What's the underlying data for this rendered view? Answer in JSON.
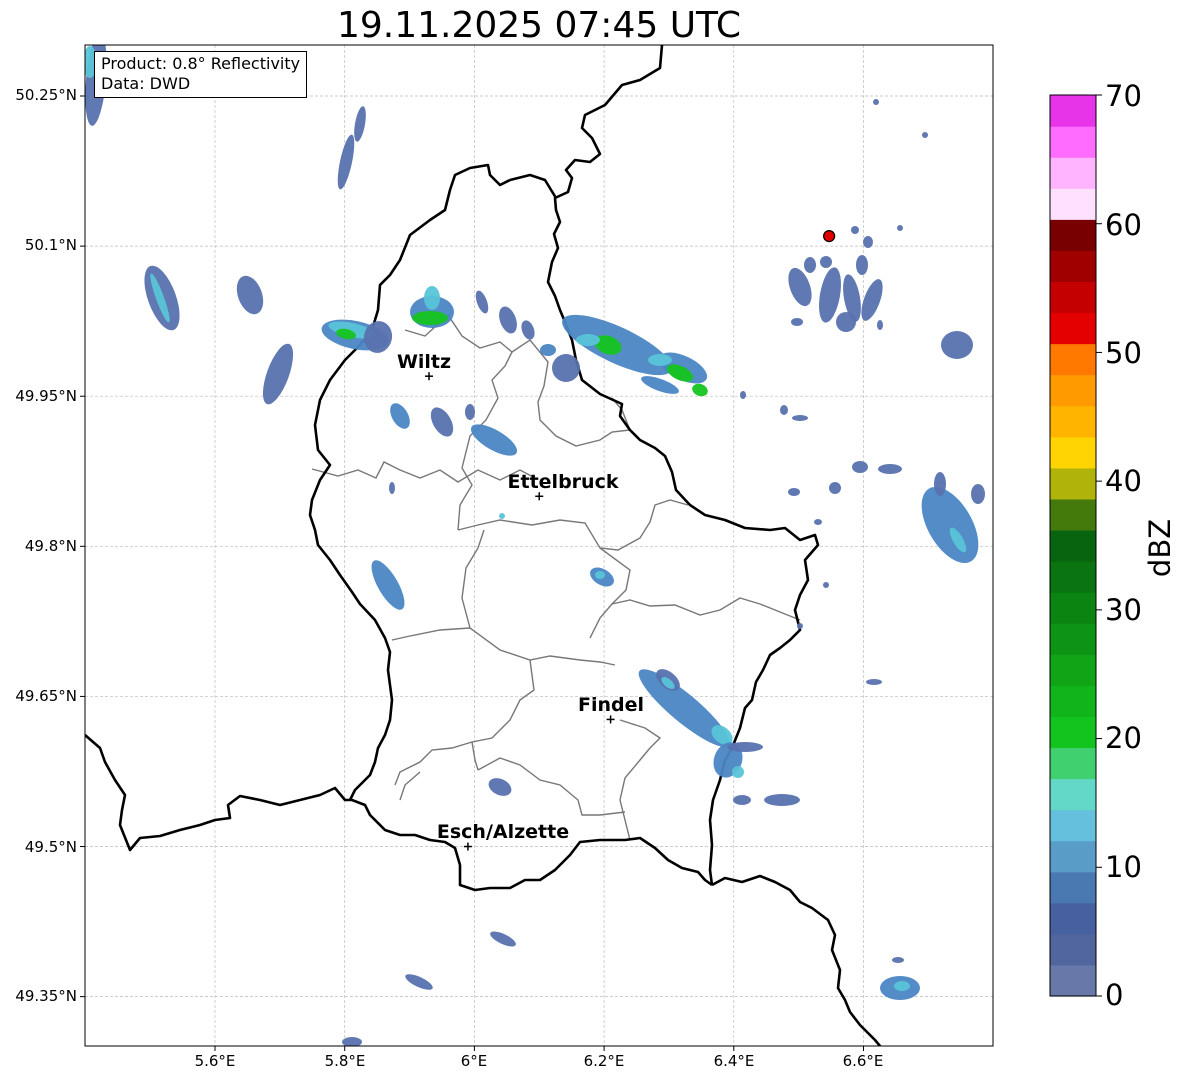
{
  "title": "19.11.2025 07:45 UTC",
  "info": {
    "product": "Product: 0.8° Reflectivity",
    "data": "Data: DWD"
  },
  "axes": {
    "lat_ticks": [
      "50.25°N",
      "50.1°N",
      "49.95°N",
      "49.8°N",
      "49.65°N",
      "49.5°N",
      "49.35°N"
    ],
    "lon_ticks": [
      "5.6°E",
      "5.8°E",
      "6°E",
      "6.2°E",
      "6.4°E",
      "6.6°E"
    ]
  },
  "cities": [
    {
      "name": "Wiltz",
      "lon": 5.93,
      "lat": 49.97
    },
    {
      "name": "Ettelbruck",
      "lon": 6.1,
      "lat": 49.85
    },
    {
      "name": "Findel",
      "lon": 6.21,
      "lat": 49.627
    },
    {
      "name": "Esch/Alzette",
      "lon": 5.99,
      "lat": 49.5
    }
  ],
  "radar_site": {
    "lon": 6.547,
    "lat": 50.11,
    "color": "#e00000"
  },
  "colorbar": {
    "label": "dBZ",
    "ticks": [
      "70",
      "60",
      "50",
      "40",
      "30",
      "20",
      "10",
      "0"
    ],
    "colors": [
      "#6878a8",
      "#52669e",
      "#4660a0",
      "#4a78b0",
      "#5a9cc8",
      "#64c0dc",
      "#64d8c8",
      "#40d070",
      "#14c41e",
      "#12b41c",
      "#10a416",
      "#0e9414",
      "#0c8412",
      "#0a7410",
      "#08640e",
      "#447a0c",
      "#b0b40a",
      "#ffd400",
      "#ffb400",
      "#ff9a00",
      "#ff7800",
      "#e40000",
      "#c40000",
      "#a00000",
      "#780000",
      "#ffe0ff",
      "#ffb4ff",
      "#ff6cff",
      "#e834e8"
    ]
  },
  "echo_colors": {
    "light": "#5872ae",
    "medium": "#4a86c4",
    "cyan": "#58c4d8",
    "green": "#16c420"
  }
}
